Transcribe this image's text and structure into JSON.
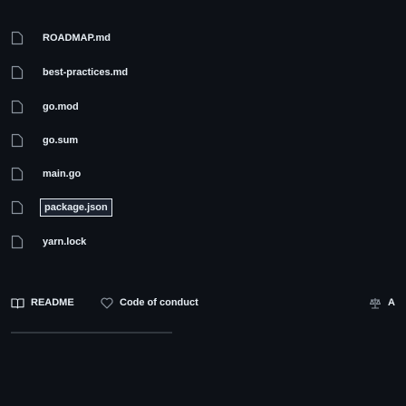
{
  "files": [
    {
      "name": "ROADMAP.md"
    },
    {
      "name": "best-practices.md"
    },
    {
      "name": "go.mod"
    },
    {
      "name": "go.sum"
    },
    {
      "name": "main.go"
    },
    {
      "name": "package.json",
      "selected": true
    },
    {
      "name": "yarn.lock"
    }
  ],
  "tabs": [
    {
      "label": "README",
      "icon": "book-icon"
    },
    {
      "label": "Code of conduct",
      "icon": "heart-icon"
    },
    {
      "label": "A",
      "icon": "scale-icon"
    }
  ],
  "colors": {
    "background": "#0d1117",
    "text": "#e6edf3",
    "muted": "#8b949e",
    "selection_border": "#e6edf3"
  }
}
